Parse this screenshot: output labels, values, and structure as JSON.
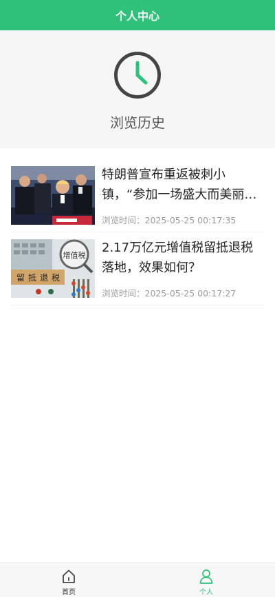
{
  "header": {
    "title": "个人中心"
  },
  "hero": {
    "icon": "clock-icon",
    "label": "浏览历史",
    "accent": "#2fc17a"
  },
  "history": {
    "items": [
      {
        "title": "特朗普宣布重返被刺小镇，“参加一场盛大而美丽的集会”",
        "meta": "浏览时间：2025-05-25 00:17:35",
        "image": "news-photo"
      },
      {
        "title": "2.17万亿元增值税留抵退税落地，效果如何？",
        "meta": "浏览时间：2025-05-25 00:17:27",
        "image": "tax-refund-photo",
        "image_text": [
          "增值税",
          "留",
          "抵",
          "退",
          "税"
        ]
      }
    ]
  },
  "tabbar": {
    "items": [
      {
        "label": "首页",
        "icon": "home-icon",
        "active": false
      },
      {
        "label": "个人",
        "icon": "person-icon",
        "active": true
      }
    ]
  }
}
